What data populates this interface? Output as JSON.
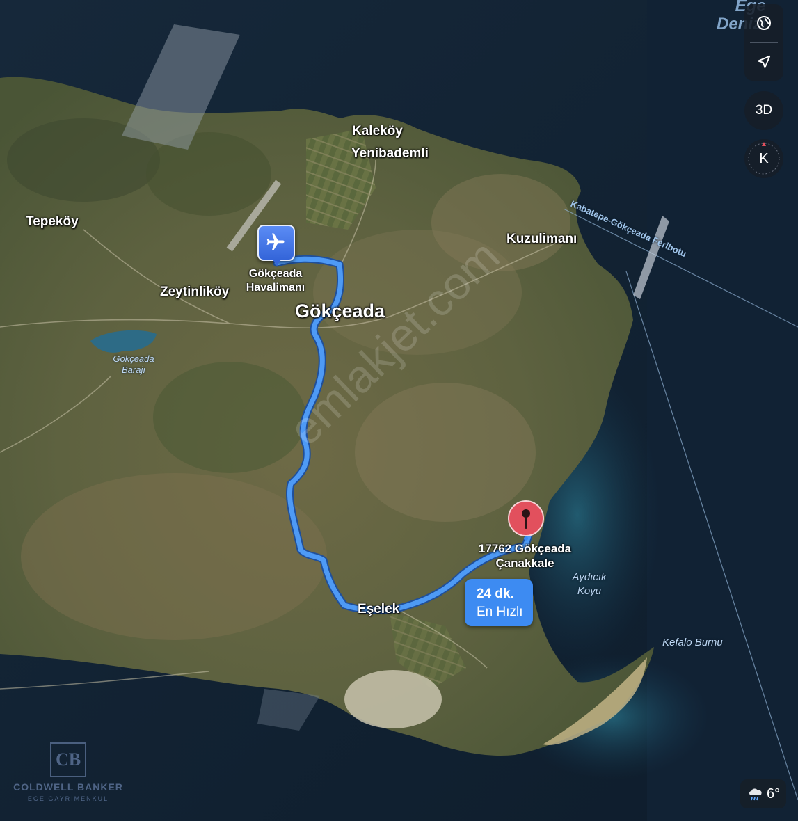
{
  "map": {
    "sea_title": [
      "Ege",
      "Denizi"
    ],
    "places": {
      "kalekoy": "Kaleköy",
      "yenibademli": "Yenibademli",
      "tepekoy": "Tepeköy",
      "kuzulimani": "Kuzulimanı",
      "zeytinlikoy": "Zeytinliköy",
      "gokceada": "Gökçeada",
      "eselek": "Eşelek"
    },
    "water_labels": {
      "baraj": [
        "Gökçeada",
        "Barajı"
      ],
      "aydicik": [
        "Aydıcık",
        "Koyu"
      ],
      "kefalo": "Kefalo Burnu"
    },
    "ferry_route": "Kabatepe-Gökçeada Feribotu",
    "airport": {
      "icon": "airplane-icon",
      "label": [
        "Gökçeada",
        "Havalimanı"
      ]
    },
    "destination": {
      "icon": "map-pin-icon",
      "label": [
        "17762 Gökçeada",
        "Çanakkale"
      ]
    },
    "route": {
      "duration": "24 dk.",
      "type": "En Hızlı"
    },
    "watermark": "emlakjet.com",
    "colors": {
      "route": "#3d8bf2",
      "sea": "#14273a",
      "land": "#6b6a45",
      "pin": "#e2505d"
    }
  },
  "controls": {
    "globe_icon": "globe-icon",
    "location_icon": "location-arrow-icon",
    "mode_3d": "3D",
    "compass_label": "K"
  },
  "weather": {
    "icon": "rain-cloud-icon",
    "temperature": "6°"
  },
  "brand": {
    "logo_text": "CB",
    "name": "COLDWELL BANKER",
    "sub": "EGE GAYRİMENKUL"
  }
}
